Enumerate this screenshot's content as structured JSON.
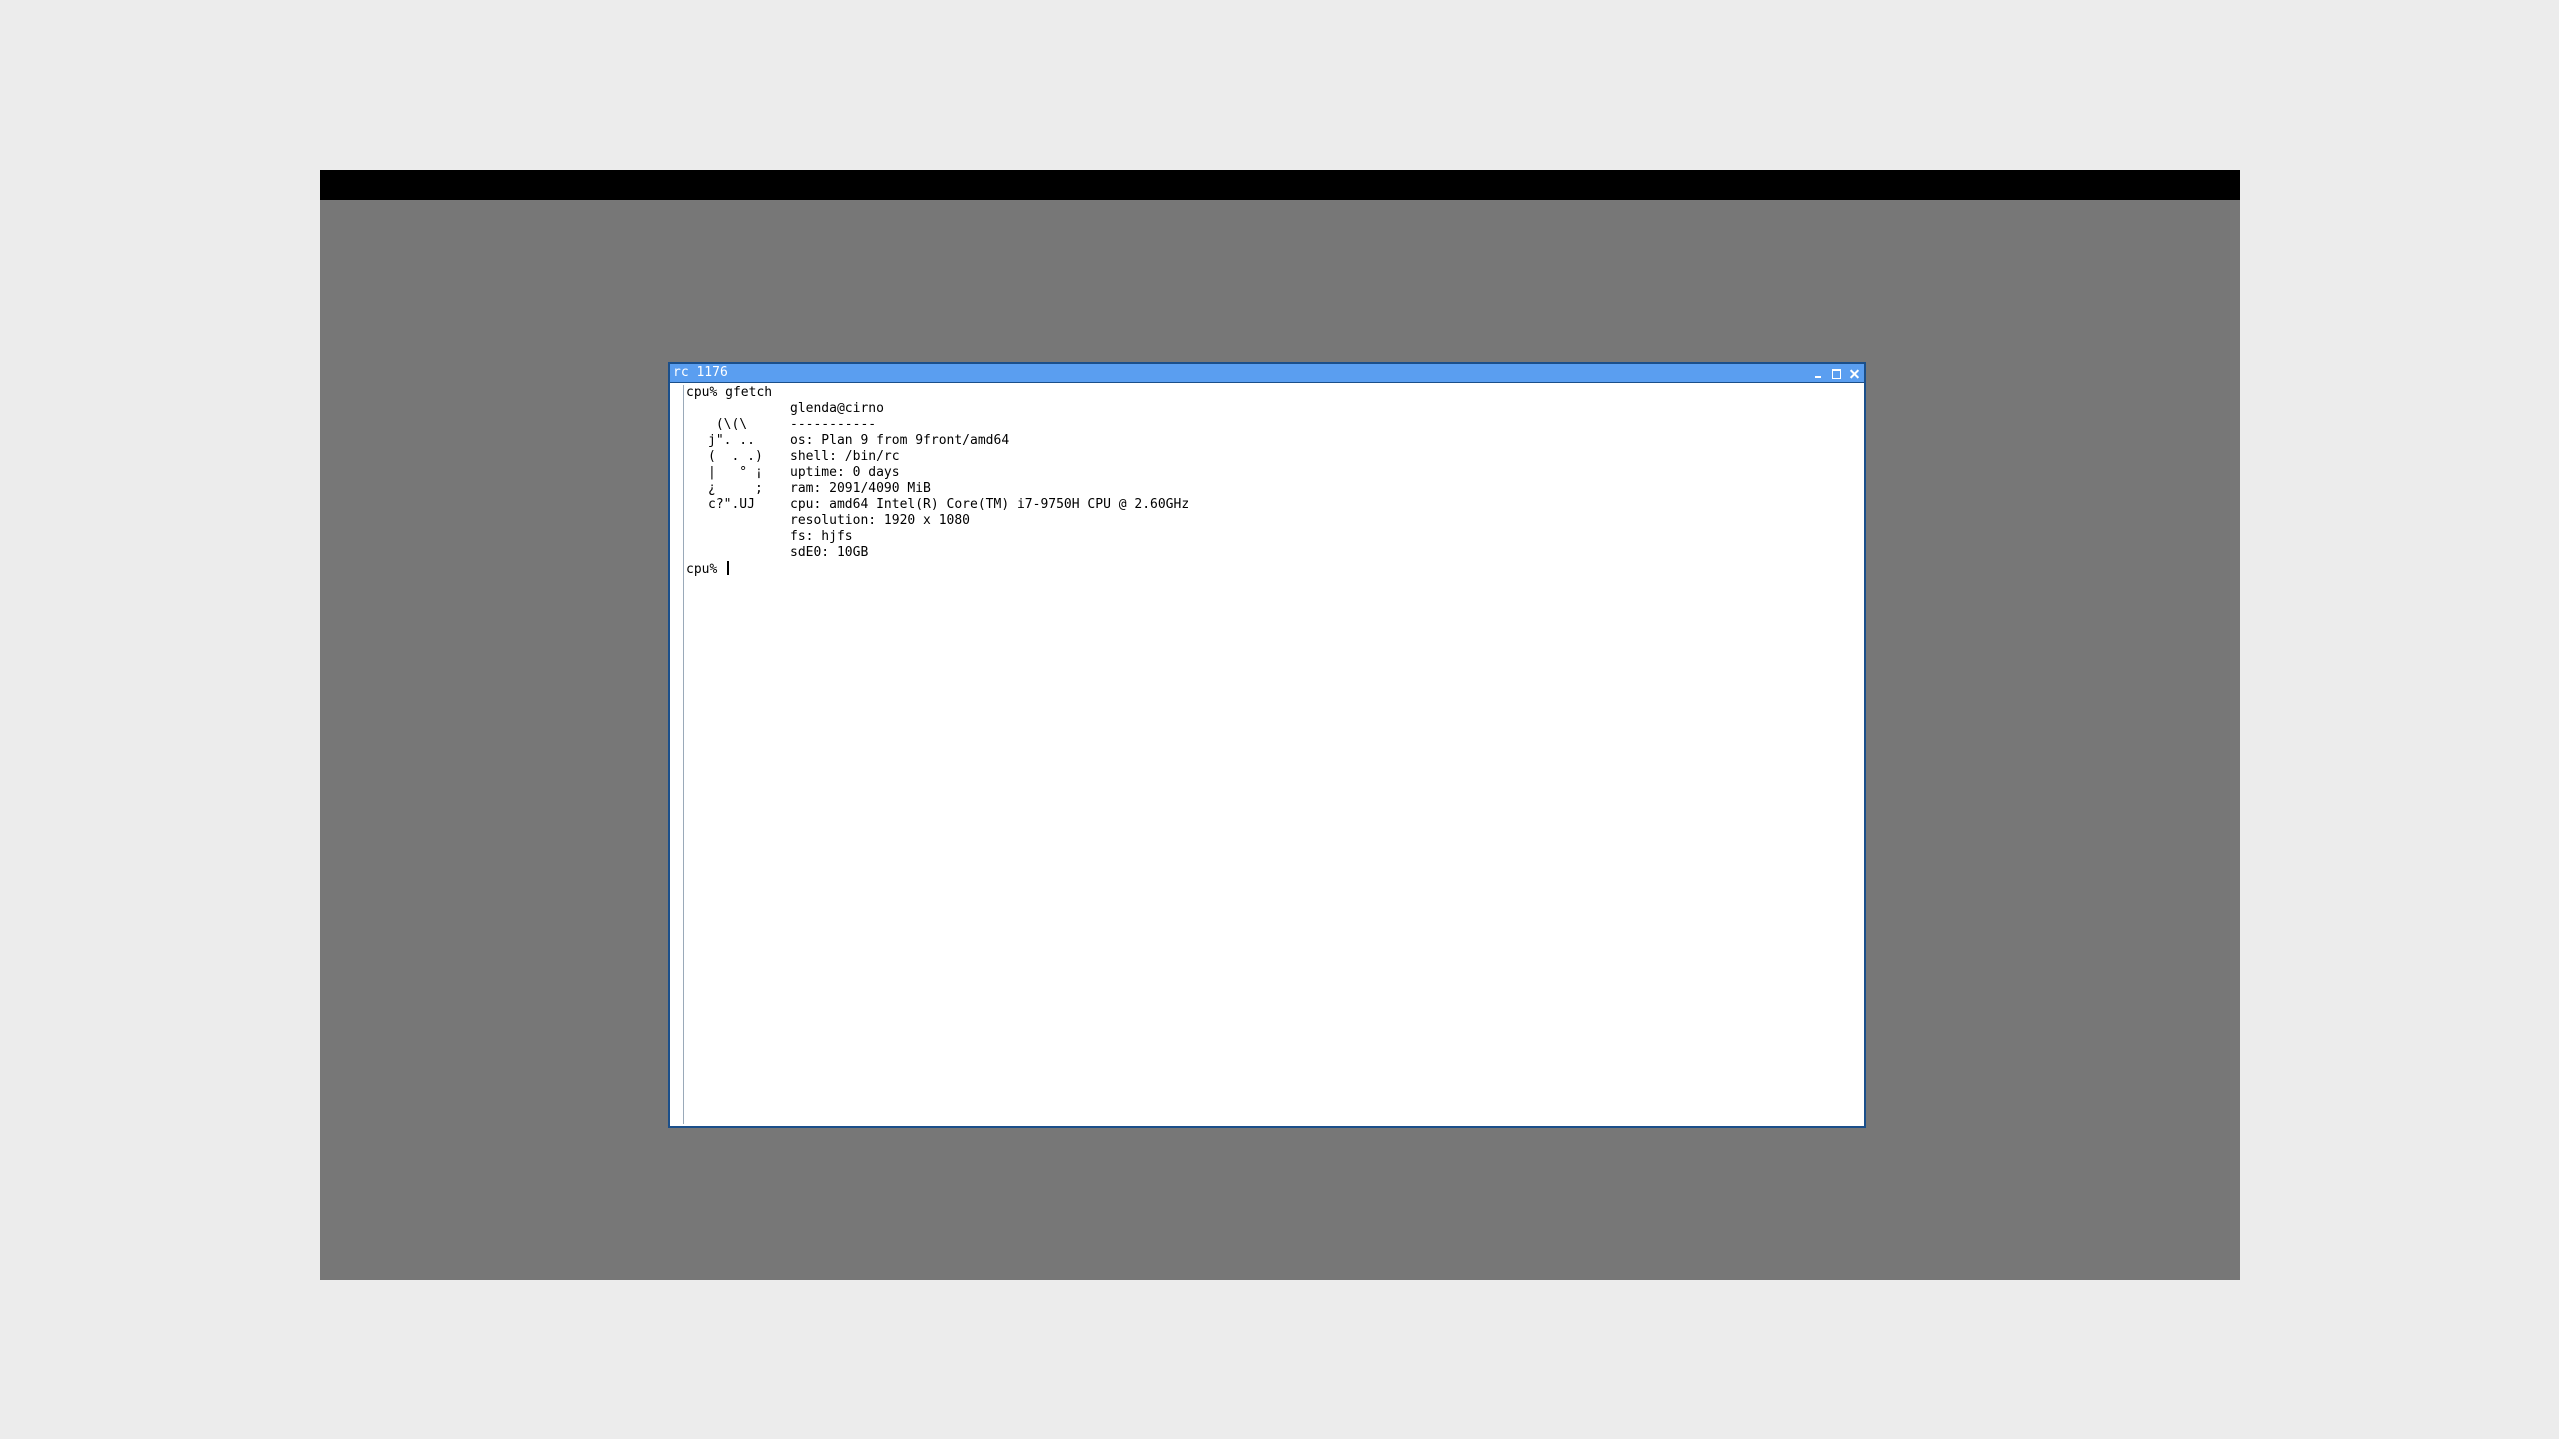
{
  "window": {
    "title": "rc 1176"
  },
  "terminal": {
    "command_line": "cpu% gfetch",
    "info": {
      "user_host": "glenda@cirno",
      "separator": "-----------",
      "os": "os: Plan 9 from 9front/amd64",
      "shell": "shell: /bin/rc",
      "uptime": "uptime: 0 days",
      "ram": "ram: 2091/4090 MiB",
      "cpu": "cpu: amd64 Intel(R) Core(TM) i7-9750H CPU @ 2.60GHz",
      "resolution": "resolution: 1920 x 1080",
      "fs": "fs: hjfs",
      "disk": "sdE0: 10GB"
    },
    "ascii_art": [
      " (\\(\\",
      "j\". ..",
      "(  . .)",
      "|   ° ¡",
      "¿     ;",
      "c?\".UJ"
    ],
    "prompt": "cpu% "
  },
  "colors": {
    "titlebar": "#5a9ef0",
    "window_border": "#1b4f8a",
    "desktop": "#777777",
    "topbar": "#000000"
  }
}
